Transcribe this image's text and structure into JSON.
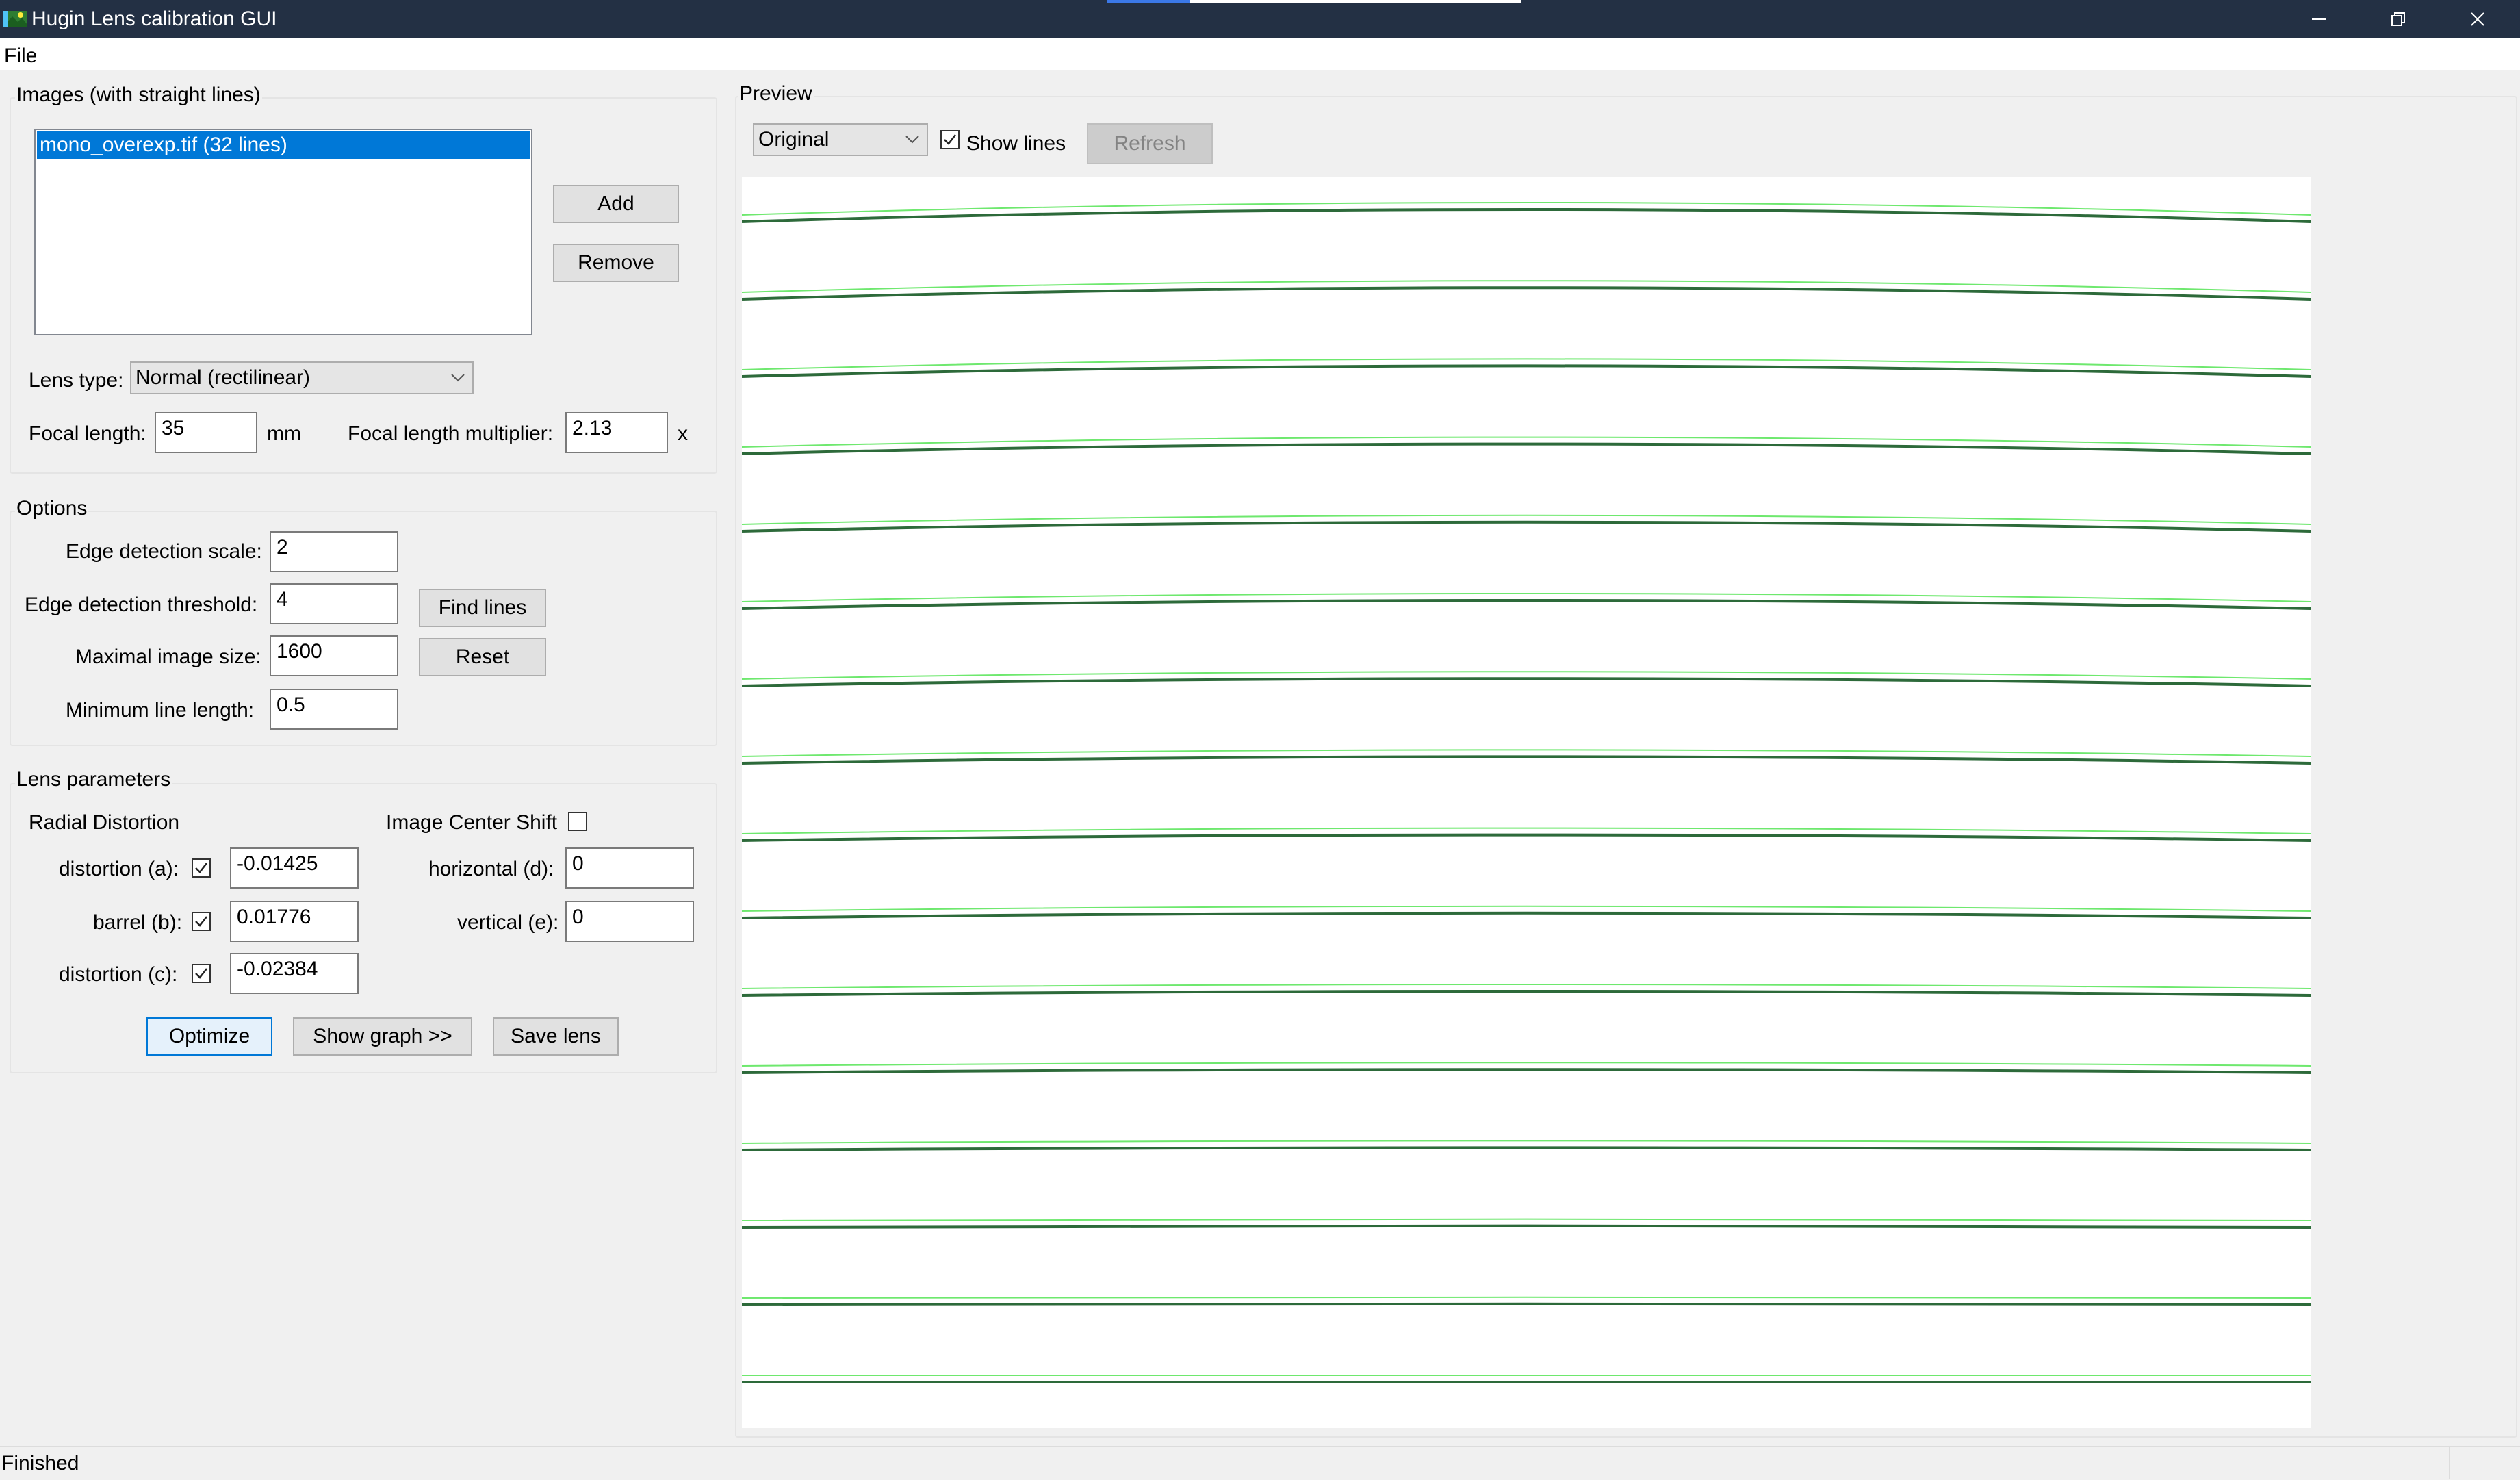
{
  "window": {
    "title": "Hugin Lens calibration GUI",
    "controls": {
      "minimize_icon": "minimize-icon",
      "restore_icon": "restore-icon",
      "close_icon": "close-icon"
    }
  },
  "menubar": {
    "file_label": "File"
  },
  "images_group": {
    "label": "Images (with straight lines)",
    "list_items": [
      "mono_overexp.tif (32 lines)"
    ],
    "add_label": "Add",
    "remove_label": "Remove",
    "lens_type_label": "Lens type:",
    "lens_type_value": "Normal (rectilinear)",
    "focal_length_label": "Focal length:",
    "focal_length_value": "35",
    "focal_length_unit": "mm",
    "multiplier_label": "Focal length multiplier:",
    "multiplier_value": "2.13",
    "multiplier_unit": "x"
  },
  "options_group": {
    "label": "Options",
    "edge_scale_label": "Edge detection scale:",
    "edge_scale_value": "2",
    "edge_threshold_label": "Edge detection threshold:",
    "edge_threshold_value": "4",
    "max_size_label": "Maximal image size:",
    "max_size_value": "1600",
    "min_line_label": "Minimum line length:",
    "min_line_value": "0.5",
    "find_lines_label": "Find lines",
    "reset_label": "Reset"
  },
  "lens_group": {
    "label": "Lens parameters",
    "radial_label": "Radial Distortion",
    "center_shift_label": "Image Center Shift",
    "center_shift_checked": false,
    "a_label": "distortion (a):",
    "a_checked": true,
    "a_value": "-0.01425",
    "b_label": "barrel (b):",
    "b_checked": true,
    "b_value": "0.01776",
    "c_label": "distortion (c):",
    "c_checked": true,
    "c_value": "-0.02384",
    "d_label": "horizontal (d):",
    "d_value": "0",
    "e_label": "vertical (e):",
    "e_value": "0",
    "optimize_label": "Optimize",
    "show_graph_label": "Show graph >>",
    "save_lens_label": "Save lens"
  },
  "preview_group": {
    "label": "Preview",
    "mode_value": "Original",
    "show_lines_label": "Show lines",
    "show_lines_checked": true,
    "refresh_label": "Refresh",
    "line_count": 16,
    "line_color_detected": "#2d6a3a",
    "line_color_fit": "#6ee86e"
  },
  "status": {
    "text": "Finished"
  }
}
